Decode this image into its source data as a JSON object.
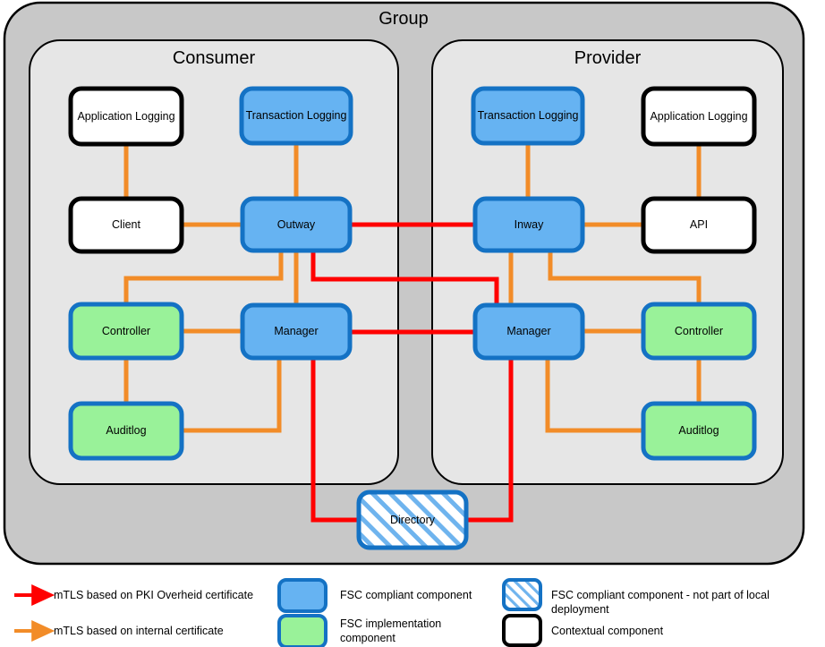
{
  "diagram": {
    "title": "Group",
    "panels": [
      {
        "id": "consumer",
        "title": "Consumer"
      },
      {
        "id": "provider",
        "title": "Provider"
      }
    ],
    "nodes": {
      "consumer_application_logging": "Application Logging",
      "consumer_transaction_logging": "Transaction Logging",
      "consumer_client": "Client",
      "consumer_outway": "Outway",
      "consumer_controller": "Controller",
      "consumer_manager": "Manager",
      "consumer_auditlog": "Auditlog",
      "provider_transaction_logging": "Transaction Logging",
      "provider_application_logging": "Application Logging",
      "provider_inway": "Inway",
      "provider_api": "API",
      "provider_manager": "Manager",
      "provider_controller": "Controller",
      "provider_auditlog": "Auditlog",
      "directory": "Directory"
    },
    "colors": {
      "group_fill": "#c8c8c8",
      "panel_fill": "#e6e6e6",
      "fsc_compliant_fill": "#66b3f2",
      "fsc_compliant_stroke": "#1472c4",
      "fsc_implementation_fill": "#99f299",
      "contextual_stroke": "#000000",
      "contextual_fill": "#ffffff",
      "mtls_pki": "#ff0000",
      "mtls_internal": "#f28c28",
      "hatch_stroke": "#4d9de0"
    }
  },
  "legend": {
    "items": [
      {
        "id": "mtls-pki",
        "kind": "arrow",
        "color": "#ff0000",
        "label": "mTLS based on PKI Overheid certificate"
      },
      {
        "id": "mtls-internal",
        "kind": "arrow",
        "color": "#f28c28",
        "label": "mTLS based on internal certificate"
      },
      {
        "id": "fsc-compliant",
        "kind": "box-blue",
        "label": "FSC compliant component"
      },
      {
        "id": "fsc-implementation",
        "kind": "box-green",
        "label": "FSC implementation component"
      },
      {
        "id": "fsc-compliant-remote",
        "kind": "box-hatched",
        "label": "FSC compliant component - not part of local deployment"
      },
      {
        "id": "contextual",
        "kind": "box-white",
        "label": "Contextual component"
      }
    ]
  }
}
